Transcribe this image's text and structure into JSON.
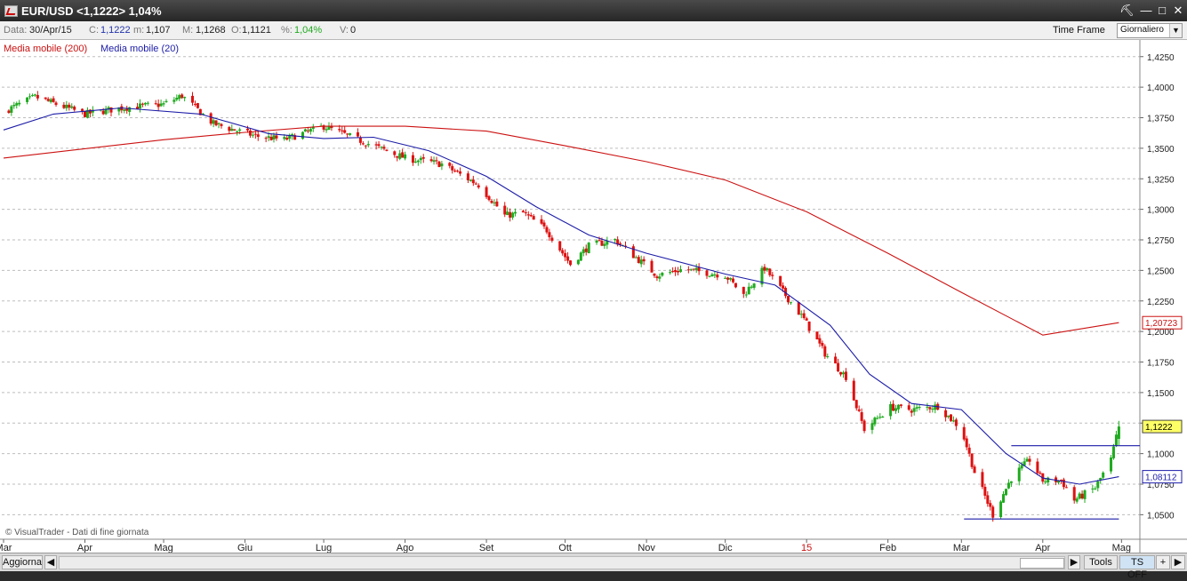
{
  "window": {
    "title": "EUR/USD <1,1222> 1,04%",
    "buttons": {
      "tool": "⛏",
      "minimize": "—",
      "maximize": "□",
      "close": "✕"
    }
  },
  "infobar": {
    "date_label": "Data:",
    "date_value": "30/Apr/15",
    "close_label": "C:",
    "close_value": "1,1222",
    "min_label": "m:",
    "min_value": "1,107",
    "max_label": "M:",
    "max_value": "1,1268",
    "open_label": "O:",
    "open_value": "1,1121",
    "pct_label": "%:",
    "pct_value": "1,04%",
    "vol_label": "V:",
    "vol_value": "0",
    "timeframe_label": "Time Frame",
    "timeframe_value": "Giornaliero"
  },
  "footer": {
    "refresh": "Aggiorna",
    "tools": "Tools",
    "ts_off": "TS OFF",
    "plus": "+",
    "watermark": "© VisualTrader - Dati di fine giornata"
  },
  "colors": {
    "up": "#1faa1f",
    "down": "#dd1111",
    "ma200": "#cc1111",
    "ma20": "#1c1ca8",
    "level_line": "#1c1ca8",
    "grid": "#bdbdbd",
    "last_price_bg": "#ffff66"
  },
  "chart_data": {
    "type": "candlestick",
    "ylim": [
      1.035,
      1.435
    ],
    "y_ticks": [
      "1,0500",
      "1,0750",
      "1,1000",
      "1,1250",
      "1,1500",
      "1,1750",
      "1,2000",
      "1,2250",
      "1,2500",
      "1,2750",
      "1,3000",
      "1,3250",
      "1,3500",
      "1,3750",
      "1,4000",
      "1,4250"
    ],
    "x_ticks": [
      {
        "label": "Mar",
        "date": "2014-03-01"
      },
      {
        "label": "Apr",
        "date": "2014-04-01"
      },
      {
        "label": "Mag",
        "date": "2014-05-01"
      },
      {
        "label": "Giu",
        "date": "2014-06-01"
      },
      {
        "label": "Lug",
        "date": "2014-07-01"
      },
      {
        "label": "Ago",
        "date": "2014-08-01"
      },
      {
        "label": "Set",
        "date": "2014-09-01"
      },
      {
        "label": "Ott",
        "date": "2014-10-01"
      },
      {
        "label": "Nov",
        "date": "2014-11-01"
      },
      {
        "label": "Dic",
        "date": "2014-12-01"
      },
      {
        "label": "15",
        "date": "2015-01-01",
        "highlight": true
      },
      {
        "label": "Feb",
        "date": "2015-02-01"
      },
      {
        "label": "Mar",
        "date": "2015-03-01"
      },
      {
        "label": "Apr",
        "date": "2015-04-01"
      },
      {
        "label": "Mag",
        "date": "2015-05-01"
      }
    ],
    "price_anchors": [
      [
        "2014-03-01",
        1.38
      ],
      [
        "2014-03-13",
        1.392
      ],
      [
        "2014-04-01",
        1.378
      ],
      [
        "2014-04-15",
        1.383
      ],
      [
        "2014-05-01",
        1.386
      ],
      [
        "2014-05-08",
        1.393
      ],
      [
        "2014-05-20",
        1.37
      ],
      [
        "2014-06-05",
        1.36
      ],
      [
        "2014-06-16",
        1.357
      ],
      [
        "2014-07-01",
        1.368
      ],
      [
        "2014-07-20",
        1.352
      ],
      [
        "2014-08-01",
        1.342
      ],
      [
        "2014-08-15",
        1.337
      ],
      [
        "2014-08-29",
        1.32
      ],
      [
        "2014-09-08",
        1.295
      ],
      [
        "2014-09-15",
        1.297
      ],
      [
        "2014-09-24",
        1.283
      ],
      [
        "2014-10-03",
        1.255
      ],
      [
        "2014-10-10",
        1.27
      ],
      [
        "2014-10-20",
        1.275
      ],
      [
        "2014-11-05",
        1.246
      ],
      [
        "2014-11-15",
        1.251
      ],
      [
        "2014-12-01",
        1.246
      ],
      [
        "2014-12-08",
        1.23
      ],
      [
        "2014-12-16",
        1.252
      ],
      [
        "2014-12-31",
        1.21
      ],
      [
        "2015-01-08",
        1.182
      ],
      [
        "2015-01-16",
        1.163
      ],
      [
        "2015-01-23",
        1.12
      ],
      [
        "2015-02-02",
        1.138
      ],
      [
        "2015-02-10",
        1.136
      ],
      [
        "2015-02-20",
        1.139
      ],
      [
        "2015-03-01",
        1.12
      ],
      [
        "2015-03-06",
        1.085
      ],
      [
        "2015-03-13",
        1.05
      ],
      [
        "2015-03-20",
        1.08
      ],
      [
        "2015-03-27",
        1.095
      ],
      [
        "2015-04-01",
        1.078
      ],
      [
        "2015-04-08",
        1.078
      ],
      [
        "2015-04-13",
        1.062
      ],
      [
        "2015-04-21",
        1.072
      ],
      [
        "2015-04-27",
        1.095
      ],
      [
        "2015-04-30",
        1.1222
      ]
    ],
    "ma200": {
      "name": "Media mobile (200)",
      "label": "1,20723",
      "points": [
        [
          "2014-03-01",
          1.342
        ],
        [
          "2014-05-01",
          1.357
        ],
        [
          "2014-06-01",
          1.363
        ],
        [
          "2014-07-01",
          1.368
        ],
        [
          "2014-08-01",
          1.368
        ],
        [
          "2014-09-01",
          1.364
        ],
        [
          "2014-10-01",
          1.352
        ],
        [
          "2014-11-01",
          1.339
        ],
        [
          "2014-12-01",
          1.324
        ],
        [
          "2015-01-01",
          1.298
        ],
        [
          "2015-02-01",
          1.264
        ],
        [
          "2015-03-01",
          1.232
        ],
        [
          "2015-04-01",
          1.197
        ],
        [
          "2015-04-30",
          1.20723
        ]
      ]
    },
    "ma20": {
      "name": "Media mobile (20)",
      "label": "1,08112",
      "points": [
        [
          "2014-03-01",
          1.365
        ],
        [
          "2014-03-20",
          1.378
        ],
        [
          "2014-04-15",
          1.383
        ],
        [
          "2014-05-15",
          1.378
        ],
        [
          "2014-06-10",
          1.362
        ],
        [
          "2014-07-01",
          1.358
        ],
        [
          "2014-07-20",
          1.359
        ],
        [
          "2014-08-10",
          1.348
        ],
        [
          "2014-09-01",
          1.327
        ],
        [
          "2014-09-20",
          1.302
        ],
        [
          "2014-10-10",
          1.279
        ],
        [
          "2014-11-01",
          1.264
        ],
        [
          "2014-12-01",
          1.247
        ],
        [
          "2014-12-20",
          1.238
        ],
        [
          "2015-01-10",
          1.205
        ],
        [
          "2015-01-25",
          1.165
        ],
        [
          "2015-02-10",
          1.141
        ],
        [
          "2015-03-01",
          1.136
        ],
        [
          "2015-03-18",
          1.1
        ],
        [
          "2015-04-01",
          1.08
        ],
        [
          "2015-04-15",
          1.075
        ],
        [
          "2015-04-30",
          1.08112
        ]
      ]
    },
    "last_price_label": "1,1222",
    "hlines": [
      {
        "value": 1.1065,
        "from": "2015-03-20",
        "to": "2015-05-08"
      },
      {
        "value": 1.0465,
        "from": "2015-03-02",
        "to": "2015-04-30"
      }
    ]
  }
}
